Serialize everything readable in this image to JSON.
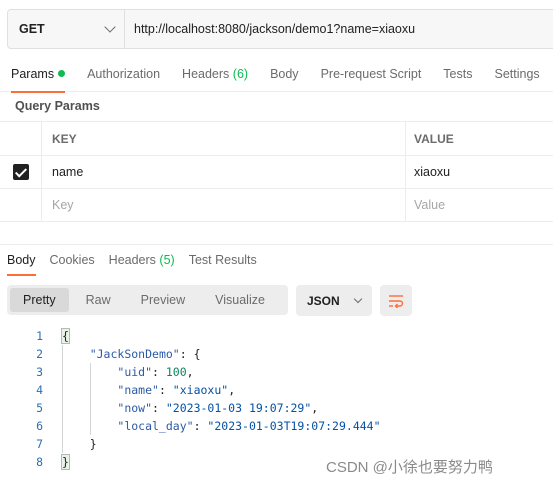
{
  "request": {
    "method": "GET",
    "url": "http://localhost:8080/jackson/demo1?name=xiaoxu"
  },
  "request_tabs": [
    {
      "label": "Params",
      "count": ""
    },
    {
      "label": "Authorization",
      "count": ""
    },
    {
      "label": "Headers",
      "count": "(6)"
    },
    {
      "label": "Body",
      "count": ""
    },
    {
      "label": "Pre-request Script",
      "count": ""
    },
    {
      "label": "Tests",
      "count": ""
    },
    {
      "label": "Settings",
      "count": ""
    }
  ],
  "query_params": {
    "title": "Query Params",
    "columns": {
      "key": "KEY",
      "value": "VALUE"
    },
    "rows": [
      {
        "checked": true,
        "key": "name",
        "value": "xiaoxu"
      }
    ],
    "placeholder": {
      "key": "Key",
      "value": "Value"
    }
  },
  "response_tabs": [
    {
      "label": "Body",
      "count": ""
    },
    {
      "label": "Cookies",
      "count": ""
    },
    {
      "label": "Headers",
      "count": "(5)"
    },
    {
      "label": "Test Results",
      "count": ""
    }
  ],
  "view_modes": [
    "Pretty",
    "Raw",
    "Preview",
    "Visualize"
  ],
  "format": "JSON",
  "icons": {
    "method_dropdown": "chevron-down-icon",
    "params_indicator": "green-dot-icon",
    "param_checkbox": "checkbox-checked-icon",
    "format_dropdown": "chevron-down-icon",
    "wrap": "wrap-lines-icon"
  },
  "colors": {
    "accent": "#ff6c37",
    "active_dot": "#0cbb52",
    "line_numbers": "#2b6fb6",
    "json_key": "#2b5aa8",
    "json_string": "#0451a5",
    "json_number": "#098658"
  },
  "code_lines": [
    "1",
    "2",
    "3",
    "4",
    "5",
    "6",
    "7",
    "8"
  ],
  "json_body": {
    "open_brace": "{",
    "close_brace": "}",
    "root_key": "\"JackSonDemo\"",
    "fields": [
      {
        "key": "\"uid\"",
        "value": "100",
        "type": "number"
      },
      {
        "key": "\"name\"",
        "value": "\"xiaoxu\"",
        "type": "string"
      },
      {
        "key": "\"now\"",
        "value": "\"2023-01-03 19:07:29\"",
        "type": "string"
      },
      {
        "key": "\"local_day\"",
        "value": "\"2023-01-03T19:07:29.444\"",
        "type": "string"
      }
    ]
  },
  "watermark": "CSDN @小徐也要努力鸭"
}
